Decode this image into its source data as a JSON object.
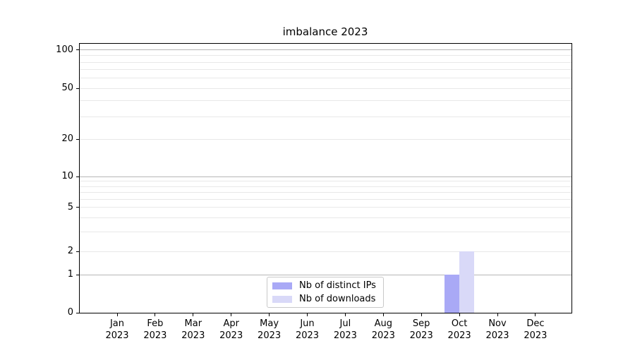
{
  "figure": {
    "title": "imbalance 2023"
  },
  "legend": {
    "items": [
      {
        "label": "Nb of distinct IPs",
        "color": "#a9a9f6"
      },
      {
        "label": "Nb of downloads",
        "color": "#d9d9f8"
      }
    ]
  },
  "chart_data": {
    "type": "bar",
    "title": "imbalance 2023",
    "categories": [
      "Jan",
      "Feb",
      "Mar",
      "Apr",
      "May",
      "Jun",
      "Jul",
      "Aug",
      "Sep",
      "Oct",
      "Nov",
      "Dec"
    ],
    "year": "2023",
    "series": [
      {
        "name": "Nb of distinct IPs",
        "color": "#a9a9f6",
        "values": [
          0,
          0,
          0,
          0,
          0,
          0,
          0,
          0,
          0,
          1,
          0,
          0
        ]
      },
      {
        "name": "Nb of downloads",
        "color": "#d9d9f8",
        "values": [
          0,
          0,
          0,
          0,
          0,
          0,
          0,
          0,
          0,
          2,
          0,
          0
        ]
      }
    ],
    "yscale": "symlog",
    "ylim": [
      0,
      100
    ],
    "yticks": [
      0,
      1,
      2,
      5,
      10,
      20,
      50,
      100
    ],
    "grid_major_values": [
      1,
      10,
      100
    ],
    "grid_minor_values": [
      2,
      3,
      4,
      5,
      6,
      7,
      8,
      9,
      20,
      30,
      40,
      50,
      60,
      70,
      80,
      90
    ],
    "grid": true,
    "legend_position": "lower center",
    "xlabel": "",
    "ylabel": ""
  },
  "colors": {
    "spine": "#000000",
    "grid_major": "#b6b6b6",
    "grid_minor": "#e8e8e8",
    "background": "#ffffff",
    "text": "#000000",
    "legend_border": "#c9c9c9"
  }
}
